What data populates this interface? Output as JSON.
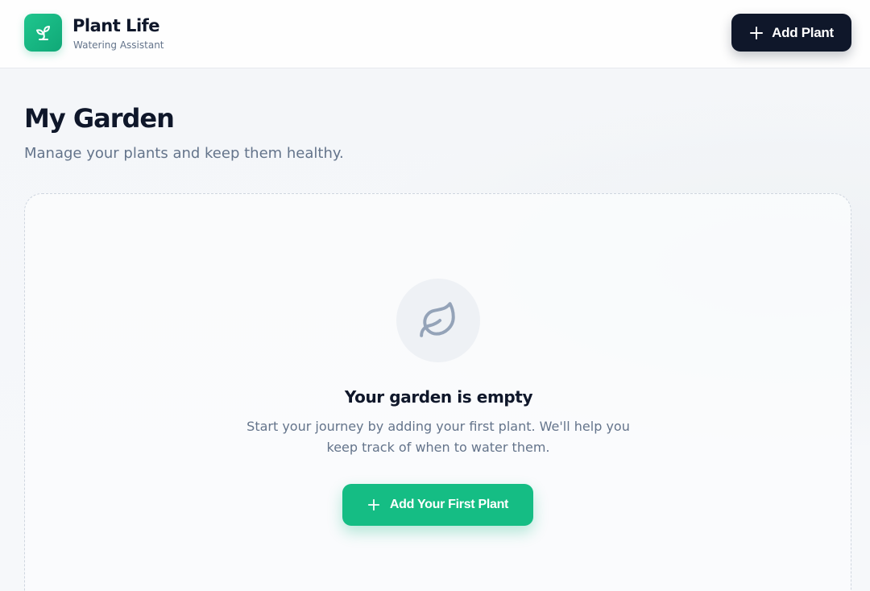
{
  "header": {
    "brand_title": "Plant Life",
    "brand_subtitle": "Watering Assistant",
    "logo_icon": "sprout-icon",
    "add_button_label": "Add Plant",
    "add_button_icon": "plus-icon"
  },
  "main": {
    "title": "My Garden",
    "subtitle": "Manage your plants and keep them healthy."
  },
  "empty_state": {
    "icon": "leaf-icon",
    "title": "Your garden is empty",
    "description": "Start your journey by adding your first plant. We'll help you keep track of when to water them.",
    "cta_label": "Add Your First Plant",
    "cta_icon": "plus-icon"
  },
  "colors": {
    "brand_green": "#15bd84",
    "dark": "#0f172a",
    "muted_text": "#64748b"
  }
}
